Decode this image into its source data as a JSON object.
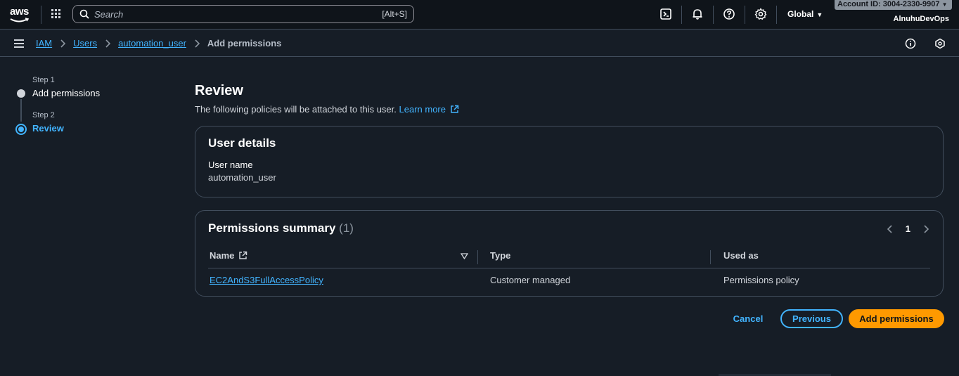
{
  "topnav": {
    "logo_text": "aws",
    "search_placeholder": "Search",
    "search_shortcut": "[Alt+S]",
    "region": "Global",
    "account_id": "Account ID: 3004-2330-9907",
    "account_name": "AlnuhuDevOps",
    "icons": [
      "apps-grid-icon",
      "cloudshell-icon",
      "bell-icon",
      "help-icon",
      "gear-icon"
    ]
  },
  "breadcrumb": {
    "items": [
      "IAM",
      "Users",
      "automation_user"
    ],
    "current": "Add permissions"
  },
  "steps": [
    {
      "label": "Step 1",
      "title": "Add permissions",
      "state": "done"
    },
    {
      "label": "Step 2",
      "title": "Review",
      "state": "current"
    }
  ],
  "main": {
    "title": "Review",
    "description": "The following policies will be attached to this user.",
    "learn_more": "Learn more"
  },
  "user_details": {
    "title": "User details",
    "user_name_label": "User name",
    "user_name_value": "automation_user"
  },
  "permissions": {
    "title": "Permissions summary",
    "count": "(1)",
    "page": "1",
    "columns": [
      "Name",
      "Type",
      "Used as"
    ],
    "rows": [
      {
        "name": "EC2AndS3FullAccessPolicy",
        "type": "Customer managed",
        "used_as": "Permissions policy"
      }
    ]
  },
  "actions": {
    "cancel": "Cancel",
    "previous": "Previous",
    "submit": "Add permissions"
  },
  "colors": {
    "accent_link": "#42b4ff",
    "primary_button": "#ff9900",
    "background": "#161d26",
    "topnav": "#0f141a",
    "border": "#414d5c"
  }
}
